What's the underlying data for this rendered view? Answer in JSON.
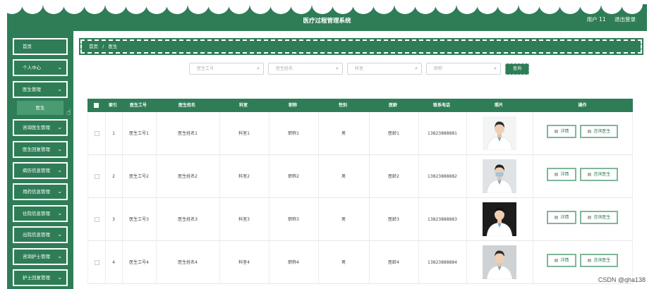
{
  "header": {
    "title": "医疗过程管理系统",
    "user": "用户 11",
    "logout": "退出登录"
  },
  "sidebar": {
    "items": [
      {
        "label": "首页",
        "has_chevron": false
      },
      {
        "label": "个人中心",
        "has_chevron": true
      },
      {
        "label": "医生管理",
        "has_chevron": true
      },
      {
        "label": "咨询医生管理",
        "has_chevron": true
      },
      {
        "label": "医生回复管理",
        "has_chevron": true
      },
      {
        "label": "病历信息管理",
        "has_chevron": true
      },
      {
        "label": "用药信息管理",
        "has_chevron": true
      },
      {
        "label": "住院信息管理",
        "has_chevron": true
      },
      {
        "label": "出院信息管理",
        "has_chevron": true
      },
      {
        "label": "咨询护士管理",
        "has_chevron": true
      },
      {
        "label": "护士回复管理",
        "has_chevron": true
      }
    ],
    "sub_item": "医生"
  },
  "breadcrumb": {
    "home": "首页",
    "sep": "/",
    "current": "医生"
  },
  "search": {
    "placeholders": [
      "医生工号",
      "医生姓名",
      "科室",
      "职称"
    ],
    "button": "查询"
  },
  "table": {
    "headers": [
      "索引",
      "医生工号",
      "医生姓名",
      "科室",
      "职称",
      "性别",
      "医龄",
      "联系电话",
      "照片",
      "操作"
    ],
    "rows": [
      {
        "index": "1",
        "id": "医生工号1",
        "name": "医生姓名1",
        "dept": "科室1",
        "title": "职称1",
        "gender": "男",
        "years": "医龄1",
        "phone": "13823888881"
      },
      {
        "index": "2",
        "id": "医生工号2",
        "name": "医生姓名2",
        "dept": "科室2",
        "title": "职称2",
        "gender": "男",
        "years": "医龄2",
        "phone": "13823888882"
      },
      {
        "index": "3",
        "id": "医生工号3",
        "name": "医生姓名3",
        "dept": "科室3",
        "title": "职称3",
        "gender": "男",
        "years": "医龄3",
        "phone": "13823888883"
      },
      {
        "index": "4",
        "id": "医生工号4",
        "name": "医生姓名4",
        "dept": "科室4",
        "title": "职称4",
        "gender": "男",
        "years": "医龄4",
        "phone": "13823888884"
      }
    ],
    "actions": {
      "detail": "详情",
      "consult": "咨询医生"
    }
  },
  "watermark": "CSDN @qha138",
  "colors": {
    "primary": "#2e7d57",
    "accent_light": "#7fb79a"
  }
}
